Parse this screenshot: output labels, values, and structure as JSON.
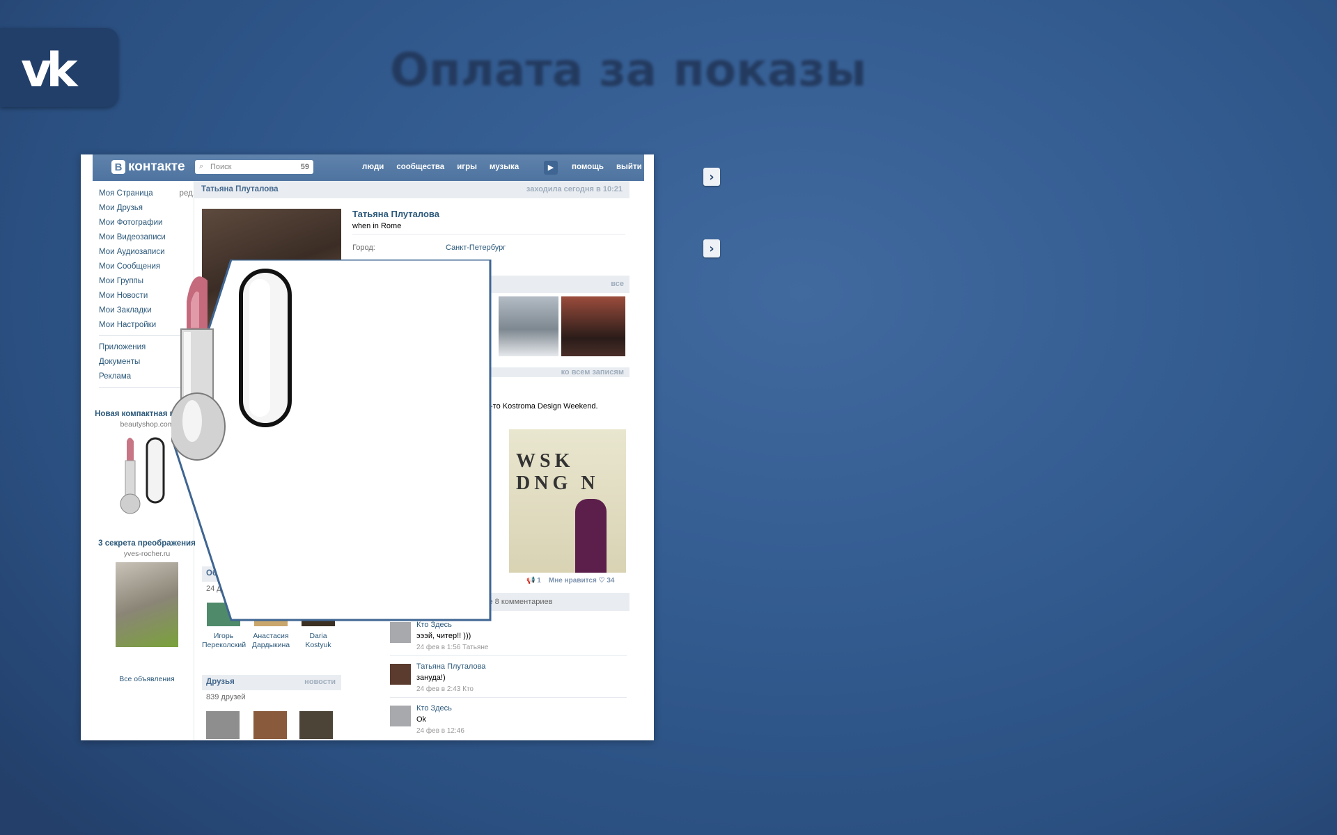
{
  "slide": {
    "title": "Оплата за показы",
    "logo_text": "vk"
  },
  "header": {
    "logo_letter": "В",
    "logo_text": "контакте",
    "search_placeholder": "Поиск",
    "search_count": "59",
    "nav": [
      "люди",
      "сообщества",
      "игры",
      "музыка"
    ],
    "nav_right": [
      "помощь",
      "выйти"
    ]
  },
  "left_menu": {
    "items": [
      "Моя Страница",
      "Мои Друзья",
      "Мои Фотографии",
      "Мои Видеозаписи",
      "Мои Аудиозаписи",
      "Мои Сообщения",
      "Мои Группы",
      "Мои Новости",
      "Мои Закладки",
      "Мои Настройки"
    ],
    "edit_label": "ред.",
    "items2": [
      "Приложения",
      "Документы",
      "Реклама"
    ]
  },
  "ads": [
    {
      "title": "Новая компактная помада",
      "domain": "beautyshop.com"
    },
    {
      "title": "3 секрета преображения",
      "domain": "yves-rocher.ru"
    }
  ],
  "all_ads": "Все объявления",
  "profile": {
    "bar_name": "Татьяна Плуталова",
    "last_seen": "заходила сегодня в 10:21",
    "name": "Татьяна Плуталова",
    "status": "when in Rome",
    "city_label": "Город:",
    "city_value": "Санкт-Петербург",
    "photos_all": "все",
    "wall_all": "ко всем записям",
    "post_text": "-то Kostroma Design Weekend.",
    "post_likes": "1",
    "like_label": "Мне нравится",
    "like_count": "34",
    "comments_link": "се 8 комментариев"
  },
  "comments": [
    {
      "who": "Кто Здесь",
      "text": "эээй, читер!! )))",
      "date": "24 фев в 1:56 Татьяне"
    },
    {
      "who": "Татьяна Плуталова",
      "text": "зануда!)",
      "date": "24 фев в 2:43 Кто"
    },
    {
      "who": "Кто Здесь",
      "text": "Ok",
      "date": "24 фев в 12:46"
    }
  ],
  "groups_section": {
    "label_partial": "Об",
    "count_partial": "24 др"
  },
  "friends_small": [
    {
      "name1": "Игорь",
      "name2": "Переколский"
    },
    {
      "name1": "Анастасия",
      "name2": "Дардыкина"
    },
    {
      "name1": "Daria",
      "name2": "Kostyuk"
    }
  ],
  "friends_section": {
    "label": "Друзья",
    "news": "новости",
    "count": "839 друзей"
  },
  "post_image_letters": "WSK DNG N"
}
